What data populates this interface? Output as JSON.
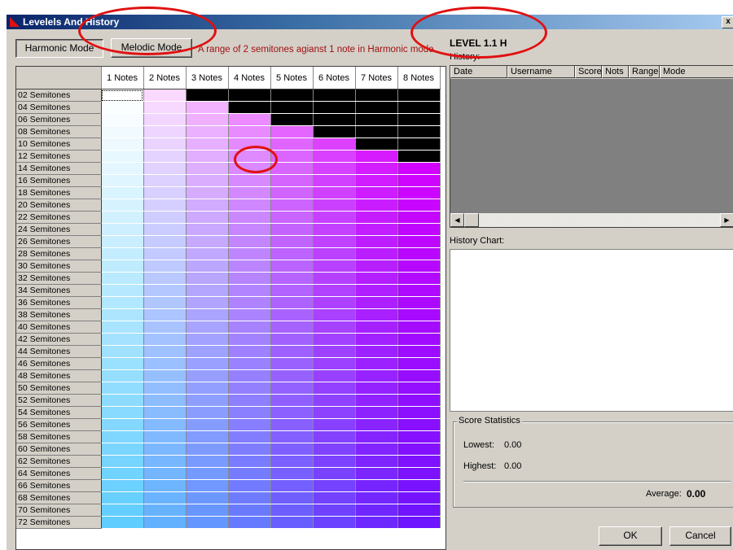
{
  "window": {
    "title": "Levelels And History",
    "close_glyph": "x"
  },
  "mode_buttons": {
    "harmonic": "Harmonic Mode",
    "melodic": "Melodic Mode"
  },
  "hint_text": "A range of 2 semitones agianst 1 note in Harmonic mode",
  "grid": {
    "columns": [
      "1 Notes",
      "2 Notes",
      "3 Notes",
      "4 Notes",
      "5 Notes",
      "6 Notes",
      "7 Notes",
      "8 Notes"
    ],
    "rows": [
      "02 Semitones",
      "04 Semitones",
      "06 Semitones",
      "08 Semitones",
      "10 Semitones",
      "12 Semitones",
      "14 Semitones",
      "16 Semitones",
      "18 Semitones",
      "20 Semitones",
      "22 Semitones",
      "24 Semitones",
      "26 Semitones",
      "28 Semitones",
      "30 Semitones",
      "32 Semitones",
      "34 Semitones",
      "36 Semitones",
      "38 Semitones",
      "40 Semitones",
      "42 Semitones",
      "44 Semitones",
      "46 Semitones",
      "48 Semitones",
      "50 Semitones",
      "52 Semitones",
      "54 Semitones",
      "56 Semitones",
      "58 Semitones",
      "60 Semitones",
      "62 Semitones",
      "64 Semitones",
      "66 Semitones",
      "68 Semitones",
      "70 Semitones",
      "72 Semitones"
    ],
    "selected": {
      "row": "02 Semitones",
      "column": "1 Notes"
    }
  },
  "level": "LEVEL 1.1 H",
  "history": {
    "label": "History:",
    "columns": [
      "Date",
      "Username",
      "Score",
      "Nots",
      "Range",
      "Mode"
    ]
  },
  "history_chart_label": "History Chart:",
  "stats": {
    "title": "Score Statistics",
    "lowest_label": "Lowest:",
    "lowest_value": "0.00",
    "highest_label": "Highest:",
    "highest_value": "0.00",
    "average_label": "Average:",
    "average_value": "0.00"
  },
  "buttons": {
    "ok": "OK",
    "cancel": "Cancel"
  },
  "colors": {
    "annotation_ring": "#e01010",
    "black_cell": "#000000",
    "hint_text": "#a01010"
  }
}
